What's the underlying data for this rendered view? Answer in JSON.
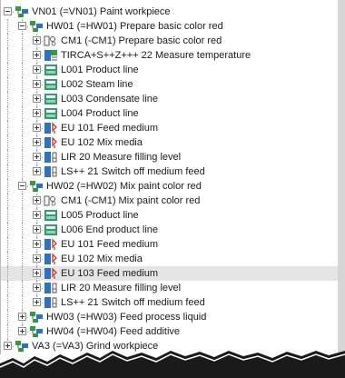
{
  "colors": {
    "selection": "#e5e5e5",
    "plant_icon_green": "#2e9e3a",
    "plant_icon_blue": "#2a72c8",
    "valve_icon_red": "#c0392b",
    "line_icon_teal": "#2e9e6e"
  },
  "tree": [
    {
      "depth": 0,
      "expand": "minus",
      "icon": "plant-hierarchy-icon",
      "label": "VN01 (=VN01) Paint workpiece"
    },
    {
      "depth": 1,
      "expand": "minus",
      "icon": "plant-hierarchy-icon",
      "label": "HW01 (=HW01) Prepare basic color red"
    },
    {
      "depth": 2,
      "expand": "plus",
      "icon": "control-module-icon",
      "label": "CM1 (-CM1) Prepare basic color red"
    },
    {
      "depth": 2,
      "expand": "plus",
      "icon": "measuring-point-icon",
      "label": "TIRCA+S++Z+++ 22 Measure temperature"
    },
    {
      "depth": 2,
      "expand": "plus",
      "icon": "product-line-icon",
      "label": "L001 Product line"
    },
    {
      "depth": 2,
      "expand": "plus",
      "icon": "product-line-icon",
      "label": "L002 Steam line"
    },
    {
      "depth": 2,
      "expand": "plus",
      "icon": "product-line-icon",
      "label": "L003 Condensate line"
    },
    {
      "depth": 2,
      "expand": "plus",
      "icon": "product-line-icon",
      "label": "L004 Product line"
    },
    {
      "depth": 2,
      "expand": "plus",
      "icon": "valve-function-icon",
      "label": "EU 101 Feed medium"
    },
    {
      "depth": 2,
      "expand": "plus",
      "icon": "valve-function-icon",
      "label": "EU 102 Mix media"
    },
    {
      "depth": 2,
      "expand": "plus",
      "icon": "level-measurement-icon",
      "label": "LIR 20 Measure filling level"
    },
    {
      "depth": 2,
      "expand": "plus",
      "icon": "level-measurement-icon",
      "label": "LS++ 21 Switch off medium feed"
    },
    {
      "depth": 1,
      "expand": "minus",
      "icon": "plant-hierarchy-icon",
      "label": "HW02 (=HW02) Mix paint color red"
    },
    {
      "depth": 2,
      "expand": "plus",
      "icon": "control-module-icon",
      "label": "CM1 (-CM1) Mix paint color red"
    },
    {
      "depth": 2,
      "expand": "plus",
      "icon": "product-line-icon",
      "label": "L005 Product line"
    },
    {
      "depth": 2,
      "expand": "plus",
      "icon": "product-line-icon",
      "label": "L006 End product line"
    },
    {
      "depth": 2,
      "expand": "plus",
      "icon": "valve-function-icon",
      "label": "EU 101 Feed medium"
    },
    {
      "depth": 2,
      "expand": "plus",
      "icon": "valve-function-icon",
      "label": "EU 102 Mix media"
    },
    {
      "depth": 2,
      "expand": "plus",
      "icon": "valve-function-icon",
      "label": "EU 103 Feed medium",
      "selected": true
    },
    {
      "depth": 2,
      "expand": "plus",
      "icon": "level-measurement-icon",
      "label": "LIR 20 Measure filling level"
    },
    {
      "depth": 2,
      "expand": "plus",
      "icon": "level-measurement-icon",
      "label": "LS++ 21 Switch off medium feed"
    },
    {
      "depth": 1,
      "expand": "plus",
      "icon": "plant-hierarchy-icon",
      "label": "HW03 (=HW03) Feed process liquid"
    },
    {
      "depth": 1,
      "expand": "plus",
      "icon": "plant-hierarchy-icon",
      "label": "HW04 (=HW04) Feed additive"
    },
    {
      "depth": 0,
      "expand": "plus",
      "icon": "plant-hierarchy-icon",
      "label": "VA3 (=VA3) Grind workpiece"
    }
  ]
}
